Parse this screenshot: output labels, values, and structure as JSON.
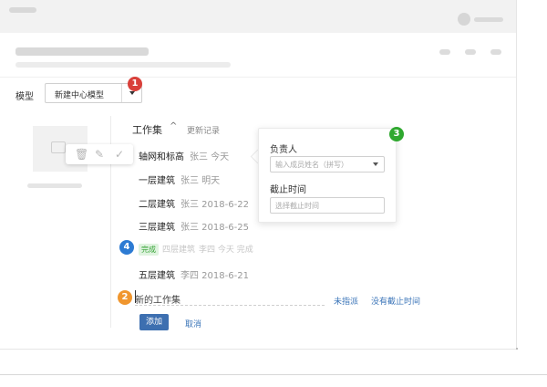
{
  "model": {
    "label": "模型",
    "selected": "新建中心模型"
  },
  "badges": [
    "1",
    "2",
    "3",
    "4"
  ],
  "workset": {
    "title": "工作集",
    "more": "更新记录"
  },
  "tasks": [
    {
      "name": "轴网和标高",
      "meta": "张三 今天"
    },
    {
      "name": "一层建筑",
      "meta": "张三 明天"
    },
    {
      "name": "二层建筑",
      "meta": "张三 2018-6-22"
    },
    {
      "name": "三层建筑",
      "meta": "张三 2018-6-25"
    },
    {
      "name": "五层建筑",
      "meta": "李四 2018-6-21"
    }
  ],
  "done_task": {
    "tag": "完成",
    "name": "四层建筑",
    "meta": "李四 今天 完成"
  },
  "popover": {
    "owner_label": "负责人",
    "owner_placeholder": "输入成员姓名（拼写）",
    "deadline_label": "截止时间",
    "deadline_placeholder": "选择截止时间"
  },
  "new_task": {
    "value": "新的工作集",
    "unassigned": "未指派",
    "no_deadline": "没有截止时间"
  },
  "actions": {
    "add": "添加",
    "cancel": "取消"
  },
  "colors": {
    "badge1": "#d9403a",
    "badge2": "#f0962e",
    "badge3": "#2fa82f",
    "badge4": "#2d7bd3",
    "primary": "#3d6fb0",
    "link": "#3a74b8"
  }
}
